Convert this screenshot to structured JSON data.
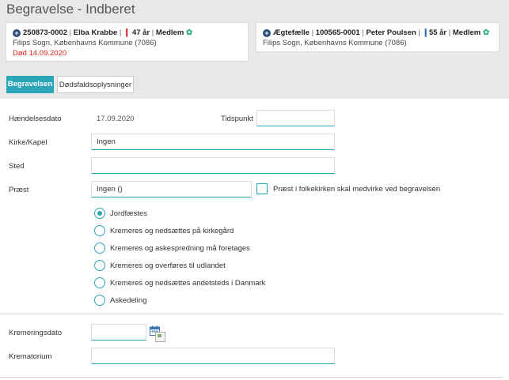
{
  "page": {
    "title": "Begravelse - Indberet"
  },
  "deceased": {
    "cpr": "250873-0002",
    "name": "Elba Krabbe",
    "age": "47 år",
    "membership": "Medlem",
    "parish": "Filips Sogn, Københavns Kommune (7086)",
    "death": "Død 14.09.2020"
  },
  "spouse": {
    "relation": "Ægtefælle",
    "cpr": "100565-0001",
    "name": "Peter Poulsen",
    "age": "55 år",
    "membership": "Medlem",
    "parish": "Filips Sogn, Københavns Kommune (7086)"
  },
  "tabs": [
    {
      "label": "Begravelsen",
      "active": true
    },
    {
      "label": "Dødsfaldsoplysninger",
      "active": false
    }
  ],
  "form": {
    "event_date_label": "Hændelsesdato",
    "event_date_value": "17.09.2020",
    "time_label": "Tidspunkt",
    "time_value": "",
    "church_label": "Kirke/Kapel",
    "church_value": "Ingen",
    "place_label": "Sted",
    "place_value": "",
    "priest_label": "Præst",
    "priest_value": "Ingen ()",
    "priest_checkbox_label": "Præst i folkekirken skal medvirke ved begravelsen",
    "burial_options": [
      {
        "label": "Jordfæstes",
        "checked": true
      },
      {
        "label": "Kremeres og nedsættes på kirkegård",
        "checked": false
      },
      {
        "label": "Kremeres og askespredning må foretages",
        "checked": false
      },
      {
        "label": "Kremeres og overføres til udlandet",
        "checked": false
      },
      {
        "label": "Kremeres og nedsættes andetsteds i Danmark",
        "checked": false
      },
      {
        "label": "Askedeling",
        "checked": false
      }
    ],
    "cremation_date_label": "Kremeringsdato",
    "cremation_date_value": "",
    "crematorium_label": "Krematorium",
    "crematorium_value": ""
  },
  "colors": {
    "accent": "#2aa6b9",
    "death": "#e0261b",
    "header_bg": "#e8e8e8"
  },
  "icons": [
    "plus-circle-icon",
    "person-female-icon",
    "person-male-icon",
    "leaf-icon",
    "calendar-icon",
    "broken-image-icon"
  ]
}
